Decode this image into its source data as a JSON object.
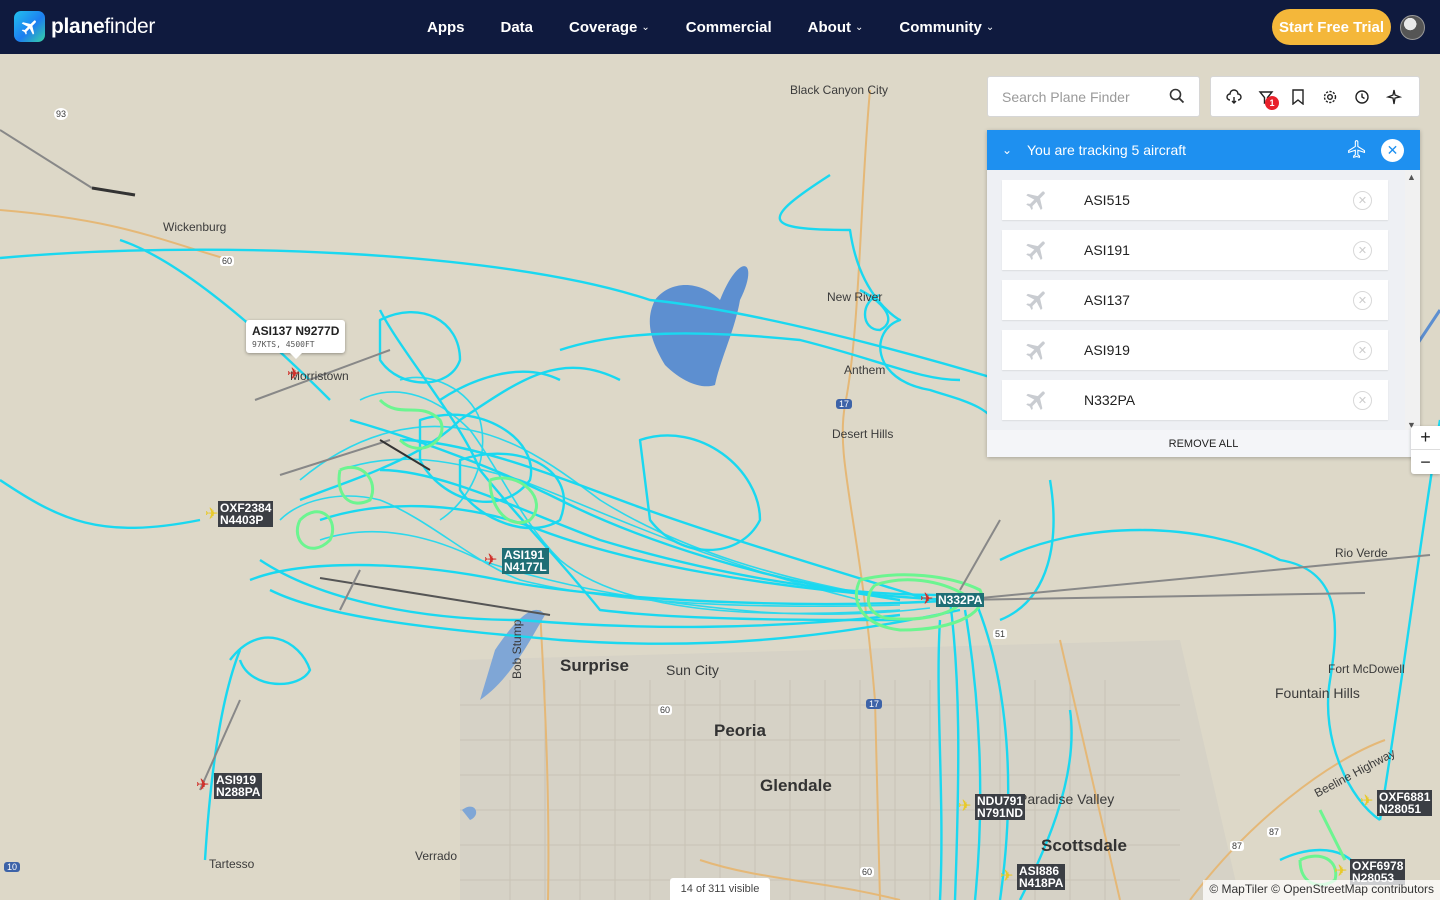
{
  "header": {
    "logo_text_bold": "plane",
    "logo_text": "finder",
    "nav": [
      {
        "label": "Apps",
        "dropdown": false
      },
      {
        "label": "Data",
        "dropdown": false
      },
      {
        "label": "Coverage",
        "dropdown": true
      },
      {
        "label": "Commercial",
        "dropdown": false
      },
      {
        "label": "About",
        "dropdown": true
      },
      {
        "label": "Community",
        "dropdown": true
      }
    ],
    "cta_label": "Start Free Trial"
  },
  "search": {
    "placeholder": "Search Plane Finder"
  },
  "tools": {
    "filter_badge": "1"
  },
  "tracking": {
    "title": "You are tracking 5 aircraft",
    "items": [
      "ASI515",
      "ASI191",
      "ASI137",
      "ASI919",
      "N332PA"
    ],
    "remove_all": "REMOVE ALL"
  },
  "tooltip": {
    "title": "ASI137 N9277D",
    "detail": "97KTS, 4500FT"
  },
  "aircraft_labels": [
    {
      "line1": "OXF2384",
      "line2": "N4403P"
    },
    {
      "line1": "ASI191",
      "line2": "N4177L"
    },
    {
      "line1": "N332PA",
      "line2": ""
    },
    {
      "line1": "ASI919",
      "line2": "N288PA"
    },
    {
      "line1": "NDU791",
      "line2": "N791ND"
    },
    {
      "line1": "ASI886",
      "line2": "N418PA"
    },
    {
      "line1": "OXF6881",
      "line2": "N28051"
    },
    {
      "line1": "OXF6978",
      "line2": "N28053"
    }
  ],
  "places": {
    "black_canyon_city": "Black Canyon City",
    "wickenburg": "Wickenburg",
    "new_river": "New River",
    "anthem": "Anthem",
    "desert_hills": "Desert Hills",
    "morristown": "Morristown",
    "rio_verde": "Rio Verde",
    "fort_mcdowell": "Fort McDowell",
    "fountain_hills": "Fountain Hills",
    "surprise": "Surprise",
    "sun_city": "Sun City",
    "peoria": "Peoria",
    "glendale": "Glendale",
    "paradise_valley": "Paradise Valley",
    "scottsdale": "Scottsdale",
    "tartesso": "Tartesso",
    "verrado": "Verrado",
    "bob_stump": "Bob Stump",
    "beeline": "Beeline Highway"
  },
  "routes": {
    "r93": "93",
    "r60a": "60",
    "r17a": "17",
    "r17b": "17",
    "r60b": "60",
    "r51": "51",
    "r60c": "60",
    "r87a": "87",
    "r87b": "87",
    "r10": "10"
  },
  "footer": {
    "visible_count": "14 of 311 visible",
    "attribution": "© MapTiler © OpenStreetMap contributors"
  },
  "colors": {
    "header_bg": "#0f1a3e",
    "cta": "#f4b73a",
    "track_cyan": "#1ad8f0",
    "track_green": "#6cf590",
    "panel_head": "#1e90f0"
  }
}
